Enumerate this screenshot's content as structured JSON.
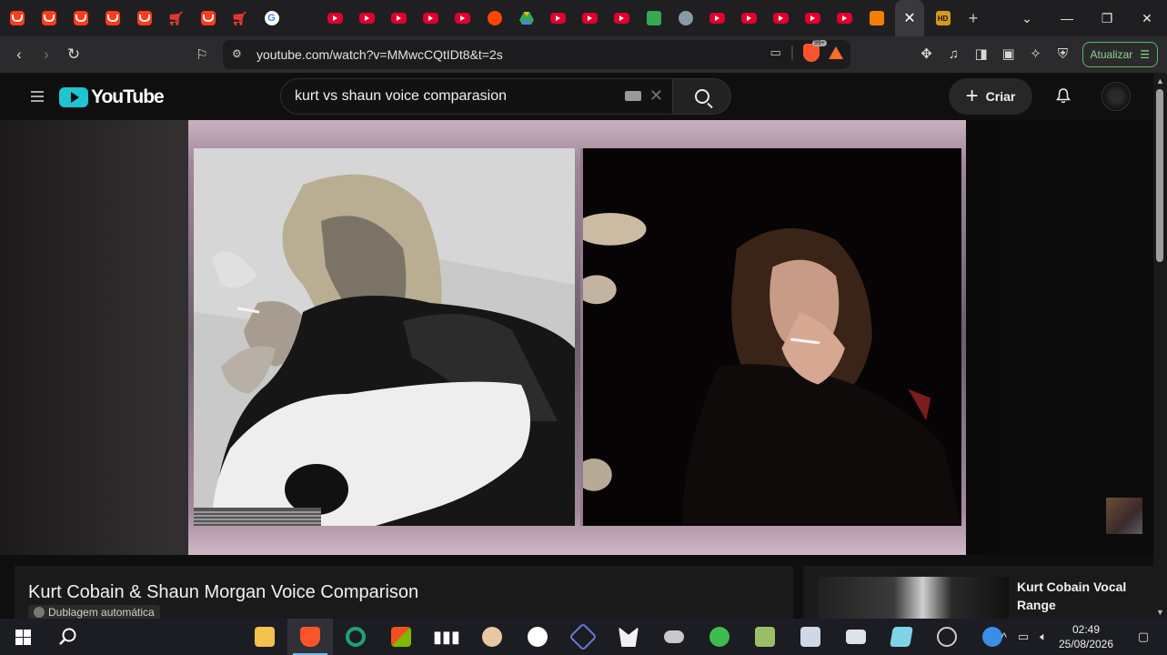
{
  "browser": {
    "tabs": [
      {
        "icon": "temu"
      },
      {
        "icon": "temu"
      },
      {
        "icon": "temu"
      },
      {
        "icon": "temu"
      },
      {
        "icon": "temu"
      },
      {
        "icon": "cart"
      },
      {
        "icon": "temu"
      },
      {
        "icon": "cart"
      },
      {
        "icon": "google",
        "letter": "G"
      },
      {
        "icon": "news"
      },
      {
        "icon": "youtube"
      },
      {
        "icon": "youtube"
      },
      {
        "icon": "youtube"
      },
      {
        "icon": "youtube"
      },
      {
        "icon": "youtube"
      },
      {
        "icon": "reddit"
      },
      {
        "icon": "drive"
      },
      {
        "icon": "youtube"
      },
      {
        "icon": "youtube"
      },
      {
        "icon": "youtube"
      },
      {
        "icon": "green-app"
      },
      {
        "icon": "cat"
      },
      {
        "icon": "youtube"
      },
      {
        "icon": "youtube"
      },
      {
        "icon": "youtube"
      },
      {
        "icon": "youtube"
      },
      {
        "icon": "youtube"
      },
      {
        "icon": "blogger"
      }
    ],
    "active_tab_close": "✕",
    "hd_tab_label": "HD",
    "new_tab": "+",
    "url": "youtube.com/watch?v=MMwcCQtIDt8&t=2s",
    "brave_badge": "99+",
    "update_button": "Atualizar"
  },
  "youtube": {
    "logo_text": "YouTube",
    "search_query": "kurt vs shaun voice comparasion",
    "create_label": "Criar",
    "video": {
      "title": "Kurt Cobain & Shaun Morgan Voice Comparison",
      "dubbing_label": "Dublagem automática"
    },
    "recommendation": {
      "title": "Kurt Cobain Vocal Range"
    }
  },
  "taskbar": {
    "time": "02:49",
    "date": "25/08/2026"
  },
  "colors": {
    "yt_logo": "#1fc4d0",
    "update_green": "#60b85a",
    "brave": "#fb542b"
  }
}
